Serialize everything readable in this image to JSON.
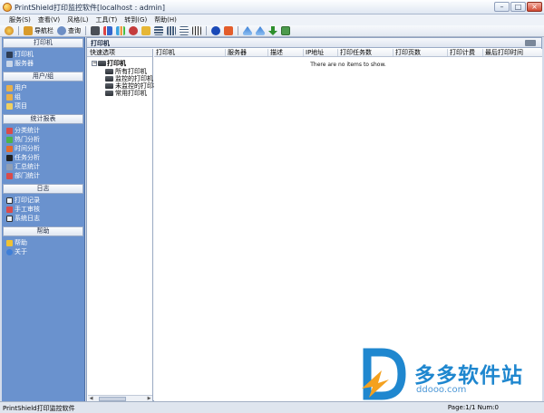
{
  "window": {
    "title": "PrintShield打印监控软件[localhost : admin]",
    "minimize": "–",
    "maximize": "□",
    "close": "×"
  },
  "menu": [
    {
      "label": "服务(S)"
    },
    {
      "label": "查看(V)"
    },
    {
      "label": "风格(L)"
    },
    {
      "label": "工具(T)"
    },
    {
      "label": "转到(G)"
    },
    {
      "label": "帮助(H)"
    }
  ],
  "toolbar": {
    "nav_label": "导航栏",
    "query_label": "查询"
  },
  "sidebar": {
    "groups": [
      {
        "title": "打印机",
        "items": [
          {
            "label": "打印机",
            "icon": "printer-icon"
          },
          {
            "label": "服务器",
            "icon": "server-icon"
          }
        ]
      },
      {
        "title": "用户/组",
        "items": [
          {
            "label": "用户",
            "icon": "user-icon"
          },
          {
            "label": "组",
            "icon": "group-icon"
          },
          {
            "label": "项目",
            "icon": "project-icon"
          }
        ]
      },
      {
        "title": "统计报表",
        "items": [
          {
            "label": "分类统计",
            "icon": "category-stats-icon"
          },
          {
            "label": "热门分析",
            "icon": "hot-analysis-icon"
          },
          {
            "label": "时间分析",
            "icon": "time-analysis-icon"
          },
          {
            "label": "任务分析",
            "icon": "task-analysis-icon"
          },
          {
            "label": "汇总统计",
            "icon": "summary-stats-icon"
          },
          {
            "label": "部门统计",
            "icon": "dept-stats-icon"
          }
        ]
      },
      {
        "title": "日志",
        "items": [
          {
            "label": "打印记录",
            "icon": "print-log-icon"
          },
          {
            "label": "手工审核",
            "icon": "manual-audit-icon"
          },
          {
            "label": "系统日志",
            "icon": "system-log-icon"
          }
        ]
      },
      {
        "title": "帮助",
        "items": [
          {
            "label": "帮助",
            "icon": "help-icon"
          },
          {
            "label": "关于",
            "icon": "about-icon"
          }
        ]
      }
    ]
  },
  "panel": {
    "title": "打印机",
    "tree": {
      "header": "快速选项",
      "root": "打印机",
      "nodes": [
        {
          "label": "所有打印机"
        },
        {
          "label": "监控的打印机"
        },
        {
          "label": "未监控的打印机"
        },
        {
          "label": "常用打印机"
        }
      ]
    },
    "grid": {
      "columns": [
        "打印机",
        "服务器",
        "描述",
        "IP地址",
        "打印任务数",
        "打印页数",
        "打印计费",
        "最后打印时间"
      ],
      "empty_message": "There are no items to show."
    }
  },
  "watermark": {
    "brand": "多多软件站",
    "url": "ddooo.com"
  },
  "status": {
    "left": "PrintShield打印监控软件",
    "right": "Page:1/1 Num:0"
  }
}
